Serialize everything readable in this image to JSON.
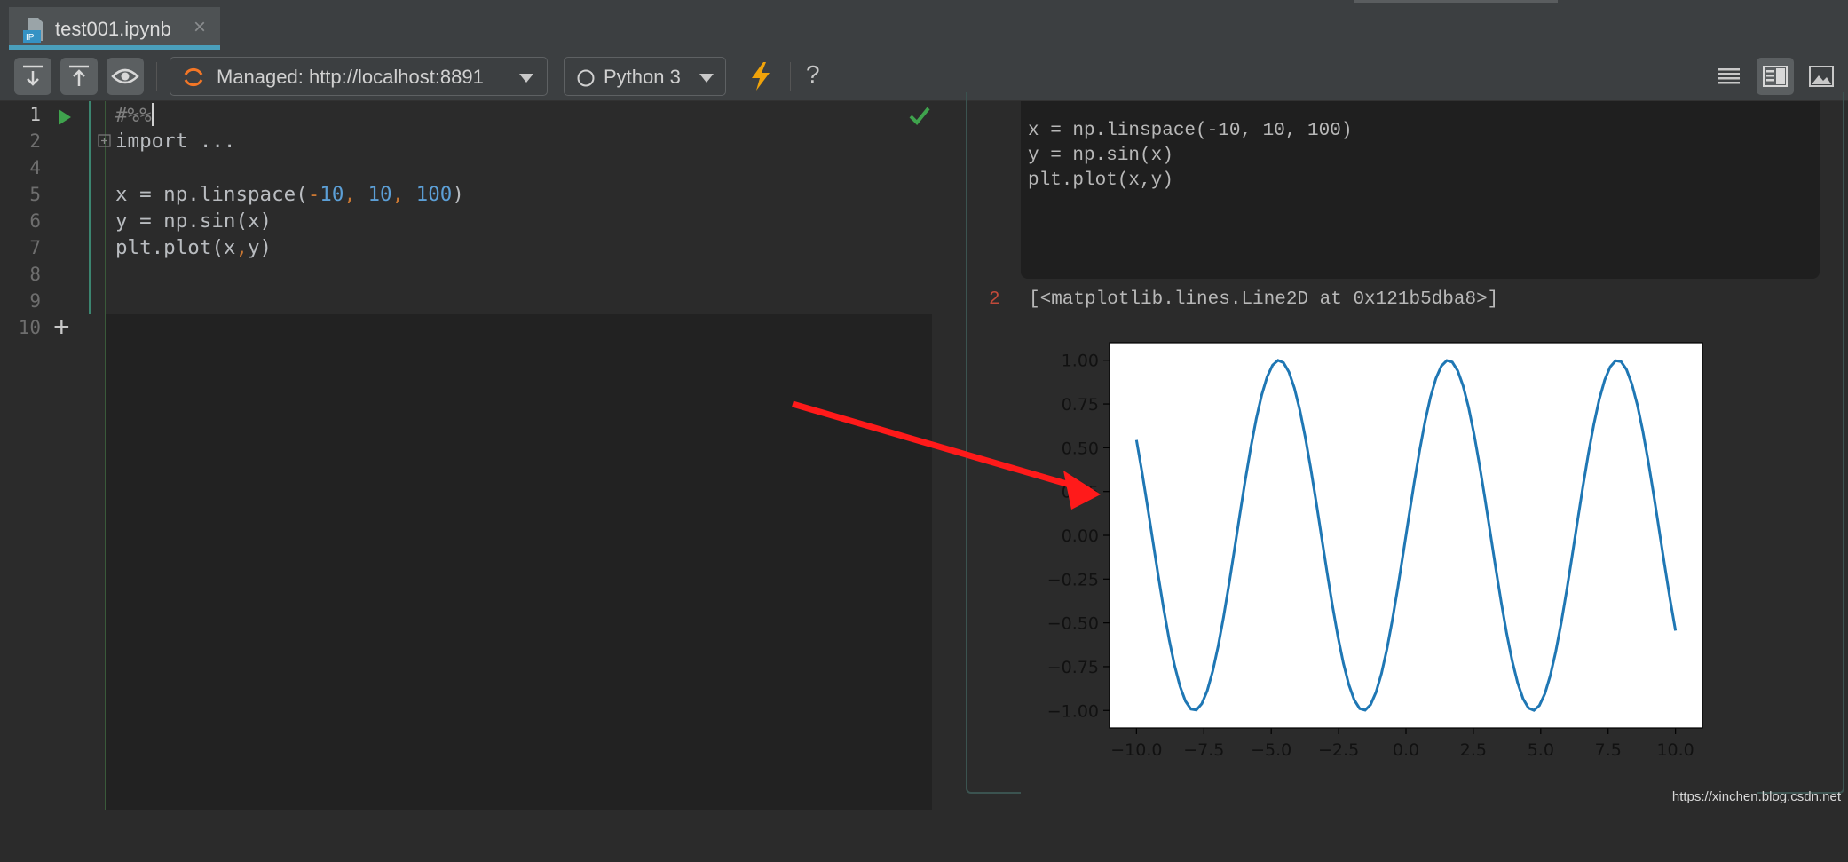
{
  "tab": {
    "filename": "test001.ipynb",
    "close_glyph": "×",
    "icon_text": "IP"
  },
  "toolbar": {
    "server_label": "Managed: http://localhost:8891",
    "kernel_label": "Python 3",
    "help_glyph": "?",
    "icons": [
      "import-notebook-icon",
      "export-notebook-icon",
      "eye-icon",
      "interrupt-kernel-icon",
      "code-only-view-icon",
      "split-view-icon",
      "preview-only-view-icon"
    ],
    "accent": "#f0a30a"
  },
  "editor": {
    "line_numbers": [
      "1",
      "2",
      "4",
      "5",
      "6",
      "7",
      "8",
      "9",
      "10"
    ],
    "cell_marker": "#%%",
    "folded_import": "import ...",
    "add_cell_glyph": "+"
  },
  "preview": {
    "code_lines": [
      "x = np.linspace(-10, 10, 100)",
      "y = np.sin(x)",
      "plt.plot(x,y)"
    ],
    "output_prompt": "2",
    "output_text": "[<matplotlib.lines.Line2D at 0x121b5dba8>]"
  },
  "chart_data": {
    "type": "line",
    "title": "",
    "xlabel": "",
    "ylabel": "",
    "xlim": [
      -11.0,
      11.0
    ],
    "ylim": [
      -1.1,
      1.1
    ],
    "x_ticks": [
      "−10.0",
      "−7.5",
      "−5.0",
      "−2.5",
      "0.0",
      "2.5",
      "5.0",
      "7.5",
      "10.0"
    ],
    "x_tick_values": [
      -10,
      -7.5,
      -5,
      -2.5,
      0,
      2.5,
      5,
      7.5,
      10
    ],
    "y_ticks": [
      "1.00",
      "0.75",
      "0.50",
      "0.25",
      "0.00",
      "−0.25",
      "−0.50",
      "−0.75",
      "−1.00"
    ],
    "y_tick_values": [
      1,
      0.75,
      0.5,
      0.25,
      0,
      -0.25,
      -0.5,
      -0.75,
      -1
    ],
    "series": [
      {
        "function": "sin(x)",
        "x_start": -10,
        "x_end": 10,
        "n_points": 100,
        "color": "#1f77b4"
      }
    ]
  },
  "watermark": "https://xinchen.blog.csdn.net"
}
